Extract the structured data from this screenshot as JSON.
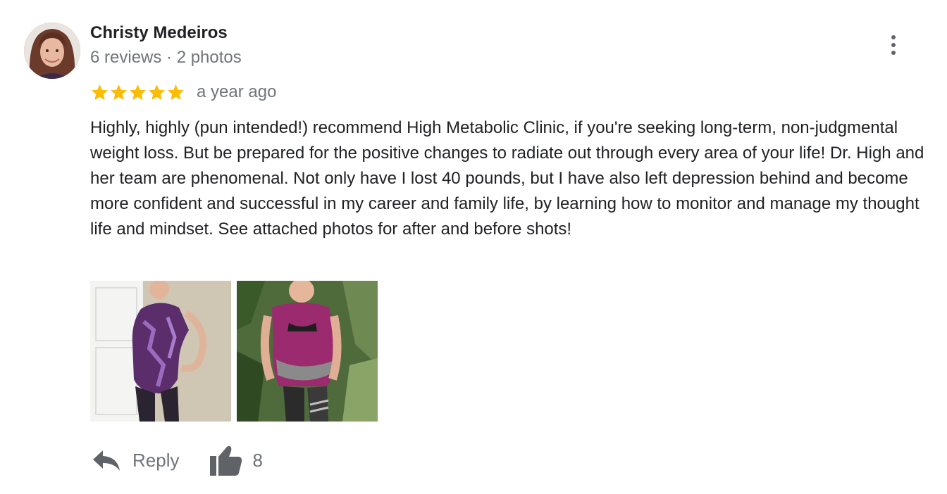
{
  "review": {
    "author": {
      "name": "Christy Medeiros",
      "meta": "6 reviews · 2 photos"
    },
    "rating": 5,
    "rating_max": 5,
    "time_ago": "a year ago",
    "text": "Highly, highly (pun intended!) recommend High Metabolic Clinic, if you're seeking long-term, non-judgmental weight loss. But be prepared for the positive changes to radiate out through every area of your life! Dr. High and her team are phenomenal. Not only have I lost 40 pounds, but I have also left depression behind and become more confident and successful in my career and family life, by learning how to monitor and manage my thought life and mindset. See attached photos for after and before shots!",
    "actions": {
      "reply_label": "Reply",
      "like_count": "8"
    }
  },
  "icons": {
    "more": "more-vert-icon",
    "star": "star-icon",
    "reply": "reply-icon",
    "like": "thumbs-up-icon"
  },
  "colors": {
    "star": "#fbbc04",
    "muted_text": "#70757a",
    "icon": "#5f6368"
  }
}
